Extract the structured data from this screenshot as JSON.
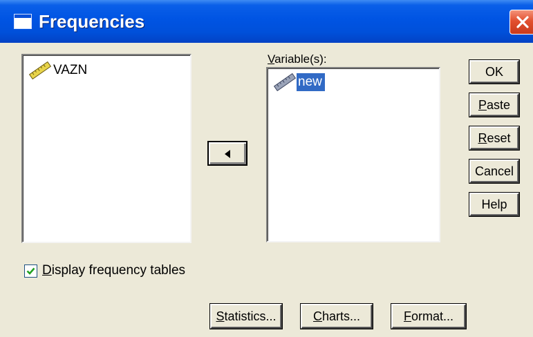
{
  "window": {
    "title": "Frequencies",
    "accent_color": "#0054e3",
    "close_color": "#e2502f"
  },
  "source_list": {
    "items": [
      {
        "label": "VAZN",
        "icon": "scale-variable-icon",
        "selected": false
      }
    ]
  },
  "target_list": {
    "label_prefix": "",
    "label_mnemonic": "V",
    "label_rest": "ariable(s):",
    "items": [
      {
        "label": "new",
        "icon": "scale-variable-icon",
        "selected": true
      }
    ]
  },
  "move_button": {
    "icon": "arrow-left-icon"
  },
  "side_buttons": {
    "ok": {
      "pre": "",
      "mn": "",
      "rest": "OK"
    },
    "paste": {
      "pre": "",
      "mn": "P",
      "rest": "aste"
    },
    "reset": {
      "pre": "",
      "mn": "R",
      "rest": "eset"
    },
    "cancel": {
      "pre": "",
      "mn": "",
      "rest": "Cancel"
    },
    "help": {
      "pre": "",
      "mn": "",
      "rest": "Help"
    }
  },
  "checkbox": {
    "checked": true,
    "pre": "",
    "mn": "D",
    "rest": "isplay frequency tables"
  },
  "bottom_buttons": {
    "statistics": {
      "pre": "",
      "mn": "S",
      "rest": "tatistics..."
    },
    "charts": {
      "pre": "",
      "mn": "C",
      "rest": "harts..."
    },
    "format": {
      "pre": "",
      "mn": "F",
      "rest": "ormat..."
    }
  },
  "colors": {
    "selection": "#316ac5",
    "dialog_bg": "#ece9d8"
  }
}
